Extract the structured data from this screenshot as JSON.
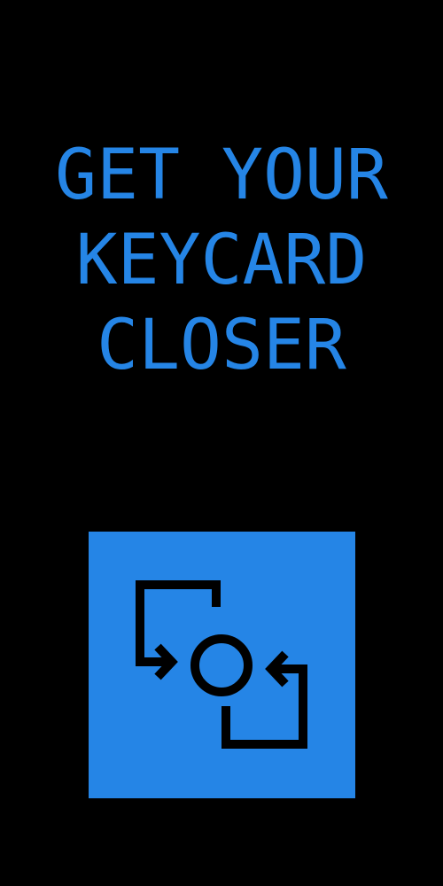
{
  "instruction": {
    "lines": [
      "GET YOUR",
      "KEYCARD",
      "CLOSER"
    ]
  },
  "keycard_button": {
    "icon": "sync-arrows-icon"
  },
  "colors": {
    "background": "#000000",
    "accent": "#2585e6",
    "icon": "#000000"
  }
}
